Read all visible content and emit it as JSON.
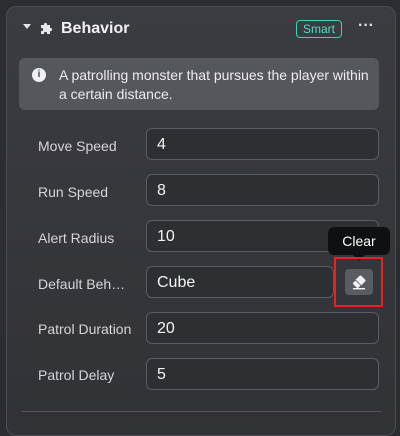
{
  "header": {
    "title": "Behavior",
    "badge": "Smart",
    "more": "···"
  },
  "info": {
    "icon": "info-icon",
    "text": "A patrolling monster that pursues the player within a certain distance."
  },
  "properties": [
    {
      "label": "Move Speed",
      "value": "4"
    },
    {
      "label": "Run Speed",
      "value": "8"
    },
    {
      "label": "Alert Radius",
      "value": "10"
    },
    {
      "label": "Default Beh…",
      "value": "Cube"
    },
    {
      "label": "Patrol Duration",
      "value": "20"
    },
    {
      "label": "Patrol Delay",
      "value": "5"
    }
  ],
  "tooltip": {
    "label": "Clear"
  },
  "colors": {
    "accent": "#3fd0b5",
    "highlight": "#e8231f"
  }
}
